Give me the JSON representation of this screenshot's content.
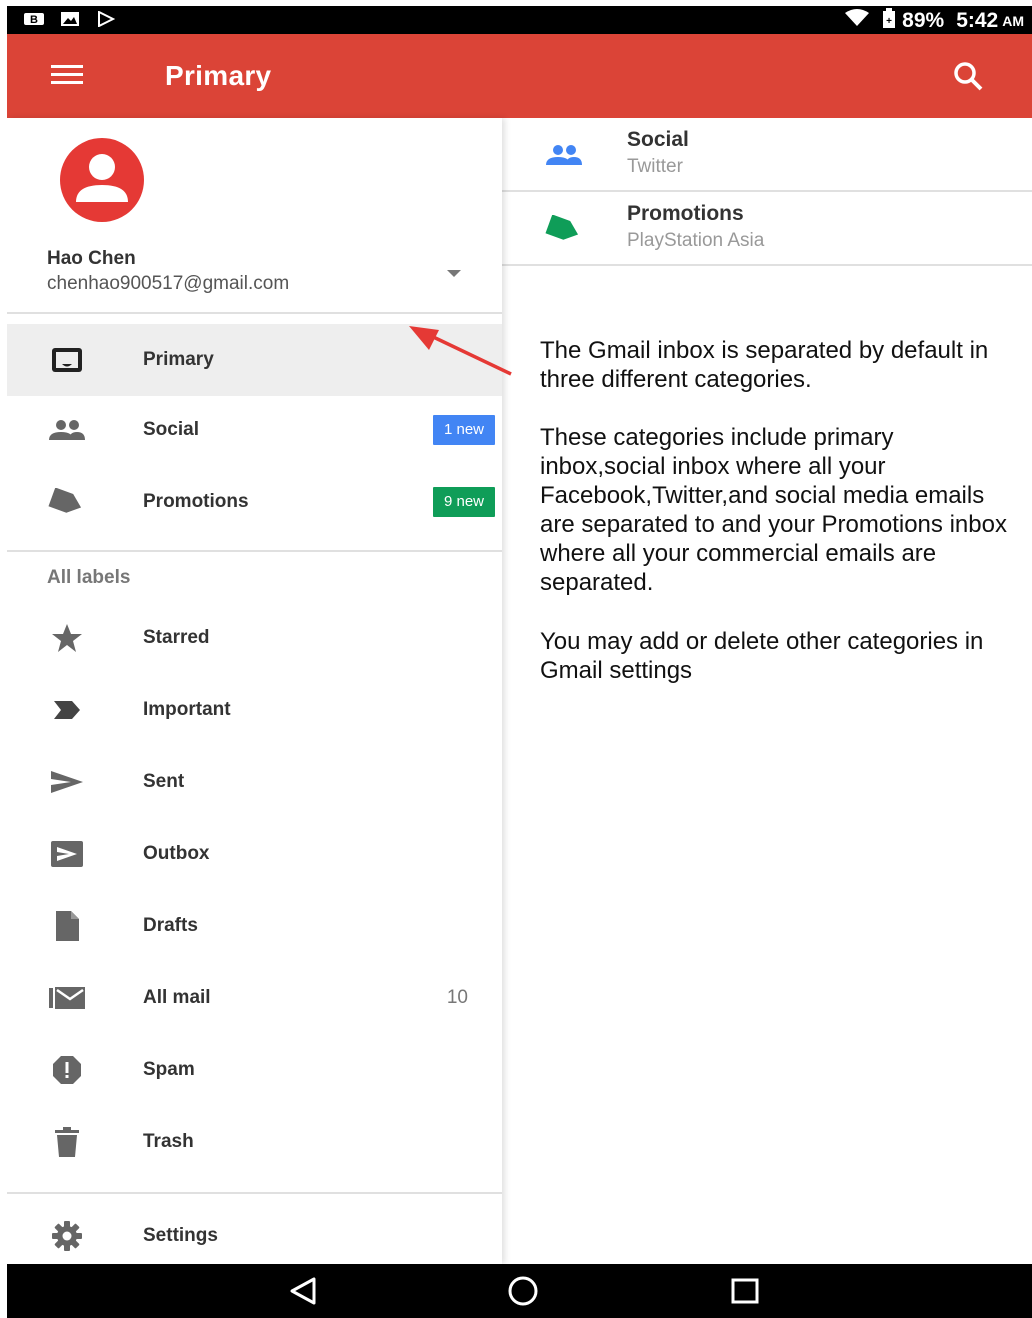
{
  "status_bar": {
    "battery": "89%",
    "time": "5:42",
    "ampm": "AM"
  },
  "app_bar": {
    "title": "Primary"
  },
  "account": {
    "name": "Hao Chen",
    "email": "chenhao900517@gmail.com"
  },
  "inbox_items": [
    {
      "label": "Primary",
      "icon": "inbox-icon",
      "active": true
    },
    {
      "label": "Social",
      "icon": "people-icon",
      "badge": "1 new",
      "badge_color": "#4285f4"
    },
    {
      "label": "Promotions",
      "icon": "tag-icon",
      "badge": "9 new",
      "badge_color": "#0f9d58"
    }
  ],
  "labels_header": "All labels",
  "labels": [
    {
      "label": "Starred",
      "icon": "star-icon"
    },
    {
      "label": "Important",
      "icon": "important-icon"
    },
    {
      "label": "Sent",
      "icon": "send-icon"
    },
    {
      "label": "Outbox",
      "icon": "outbox-icon"
    },
    {
      "label": "Drafts",
      "icon": "draft-icon"
    },
    {
      "label": "All mail",
      "icon": "all-mail-icon",
      "count": "10"
    },
    {
      "label": "Spam",
      "icon": "spam-icon"
    },
    {
      "label": "Trash",
      "icon": "trash-icon"
    }
  ],
  "settings_label": "Settings",
  "categories": [
    {
      "title": "Social",
      "subtitle": "Twitter",
      "icon": "people-icon",
      "color": "#4285f4"
    },
    {
      "title": "Promotions",
      "subtitle": "PlayStation Asia",
      "icon": "tag-icon",
      "color": "#0f9d58"
    }
  ],
  "notes": {
    "p1": "The Gmail inbox is separated by default in three different categories.",
    "p2": "These categories include primary inbox,social inbox where all your Facebook,Twitter,and social media emails are separated to and your Promotions inbox where all your commercial emails are separated.",
    "p3": "You may add or delete other categories in Gmail settings"
  },
  "colors": {
    "app_bar": "#db4437",
    "annotation_arrow": "#e53935"
  }
}
